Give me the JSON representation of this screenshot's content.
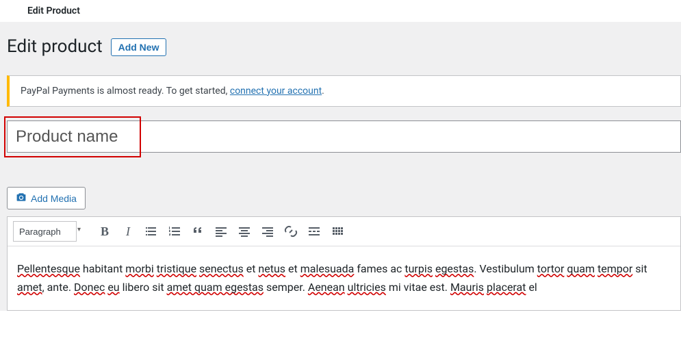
{
  "topbar": {
    "title": "Edit Product"
  },
  "header": {
    "heading": "Edit product",
    "add_new_label": "Add New"
  },
  "notice": {
    "text_before": "PayPal Payments is almost ready. To get started, ",
    "link_text": "connect your account",
    "text_after": "."
  },
  "title_input": {
    "placeholder": "Product name",
    "value": ""
  },
  "media_button": {
    "label": "Add Media"
  },
  "toolbar": {
    "format_label": "Paragraph",
    "buttons": {
      "bold": "B",
      "italic": "I",
      "ul": "bulleted-list",
      "ol": "numbered-list",
      "quote": "blockquote",
      "align_left": "align-left",
      "align_center": "align-center",
      "align_right": "align-right",
      "link": "insert-link",
      "more": "insert-more",
      "toolbar_toggle": "toolbar-toggle"
    }
  },
  "editor": {
    "word1": "Pellentesque",
    "txt1": " habitant ",
    "word2": "morbi",
    "txt2": " ",
    "word3": "tristique",
    "txt3": " ",
    "word4": "senectus",
    "txt4": " et ",
    "word5": "netus",
    "txt5": " et ",
    "word6": "malesuada",
    "txt6": " fames ac ",
    "word7": "turpis",
    "txt7": " ",
    "word8": "egestas",
    "txt8": ". Vestibulum ",
    "word9": "tortor",
    "txt9": " ",
    "word10": "quam",
    "txt10": " ",
    "word11": "tempor",
    "txt11": " sit ",
    "word12": "amet",
    "txt12": ", ante. ",
    "word13": "Donec",
    "txt13": " ",
    "word14": "eu",
    "txt14": " libero sit ",
    "word15": "amet quam egestas",
    "txt15": " semper. ",
    "word16": "Aenean",
    "txt16": " ",
    "word17": "ultricies",
    "txt17": " mi vitae est. ",
    "word18": "Mauris",
    "txt18": " ",
    "word19": "placerat",
    "txt19": " el"
  }
}
